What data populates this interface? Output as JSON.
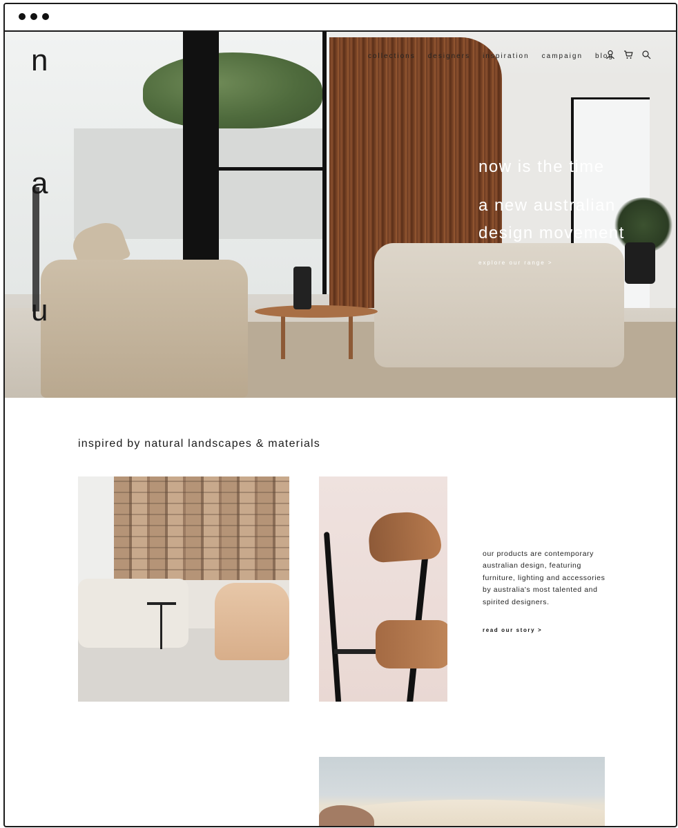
{
  "logo": {
    "letters": [
      "n",
      "a",
      "u"
    ]
  },
  "nav": {
    "items": [
      "collections",
      "designers",
      "inspiration",
      "campaign",
      "blog"
    ],
    "icons": [
      "user-icon",
      "cart-icon",
      "search-icon"
    ]
  },
  "hero": {
    "line1": "now is the time",
    "line2": "a new australian",
    "line3": "design movement",
    "cta": "explore our range  >"
  },
  "section": {
    "title": "inspired by natural landscapes & materials",
    "about": "our products are contemporary australian design, featuring furniture, lighting and accessories by australia's most talented and spirited designers.",
    "cta": "read our story  >"
  },
  "colors": {
    "text": "#1a1a1a",
    "hero_text": "#ffffff",
    "background": "#ffffff"
  }
}
